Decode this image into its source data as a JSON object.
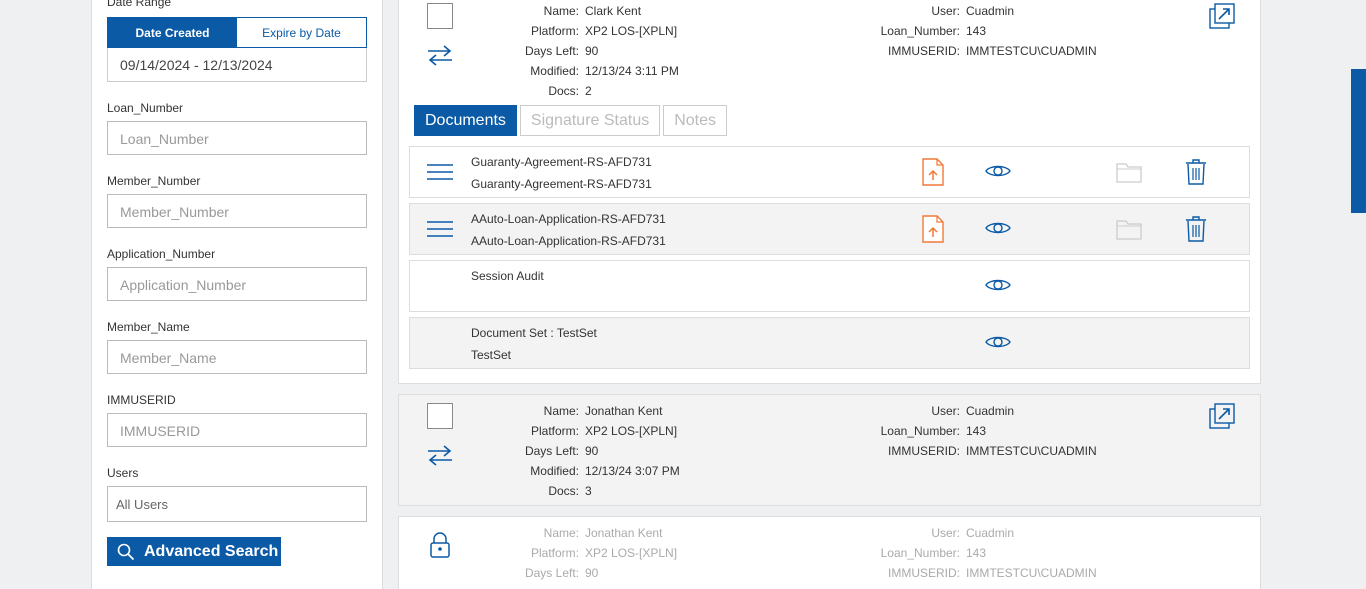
{
  "sidebar": {
    "date_range_label": "Date Range",
    "toggle": {
      "active": "Date Created",
      "inactive": "Expire by Date"
    },
    "range_value": "09/14/2024 - 12/13/2024",
    "fields": [
      {
        "label": "Loan_Number",
        "placeholder": "Loan_Number"
      },
      {
        "label": "Member_Number",
        "placeholder": "Member_Number"
      },
      {
        "label": "Application_Number",
        "placeholder": "Application_Number"
      },
      {
        "label": "Member_Name",
        "placeholder": "Member_Name"
      },
      {
        "label": "IMMUSERID",
        "placeholder": "IMMUSERID"
      }
    ],
    "users_label": "Users",
    "users_value": "All Users",
    "advanced_search": "Advanced Search"
  },
  "labels": {
    "name": "Name:",
    "platform": "Platform:",
    "days_left": "Days Left:",
    "modified": "Modified:",
    "docs": "Docs:",
    "user": "User:",
    "loan_number": "Loan_Number:",
    "immuserid": "IMMUSERID:"
  },
  "cards": [
    {
      "name": "Clark Kent",
      "platform": "XP2 LOS-[XPLN]",
      "days_left": "90",
      "modified": "12/13/24 3:11 PM",
      "docs": "2",
      "user": "Cuadmin",
      "loan_number": "143",
      "immuserid": "IMMTESTCU\\CUADMIN",
      "tabs": [
        "Documents",
        "Signature Status",
        "Notes"
      ],
      "documents": [
        {
          "line1": "Guaranty-Agreement-RS-AFD731",
          "line2": "Guaranty-Agreement-RS-AFD731"
        },
        {
          "line1": "AAuto-Loan-Application-RS-AFD731",
          "line2": "AAuto-Loan-Application-RS-AFD731"
        },
        {
          "line1": "Session Audit",
          "line2": ""
        },
        {
          "line1": "Document Set : TestSet",
          "line2": "TestSet"
        }
      ]
    },
    {
      "name": "Jonathan Kent",
      "platform": "XP2 LOS-[XPLN]",
      "days_left": "90",
      "modified": "12/13/24 3:07 PM",
      "docs": "3",
      "user": "Cuadmin",
      "loan_number": "143",
      "immuserid": "IMMTESTCU\\CUADMIN"
    },
    {
      "name": "Jonathan Kent",
      "platform": "XP2 LOS-[XPLN]",
      "days_left": "90",
      "user": "Cuadmin",
      "loan_number": "143",
      "immuserid": "IMMTESTCU\\CUADMIN"
    }
  ],
  "colors": {
    "accent": "#0b5aa6",
    "pdf_orange": "#f07a3a"
  }
}
